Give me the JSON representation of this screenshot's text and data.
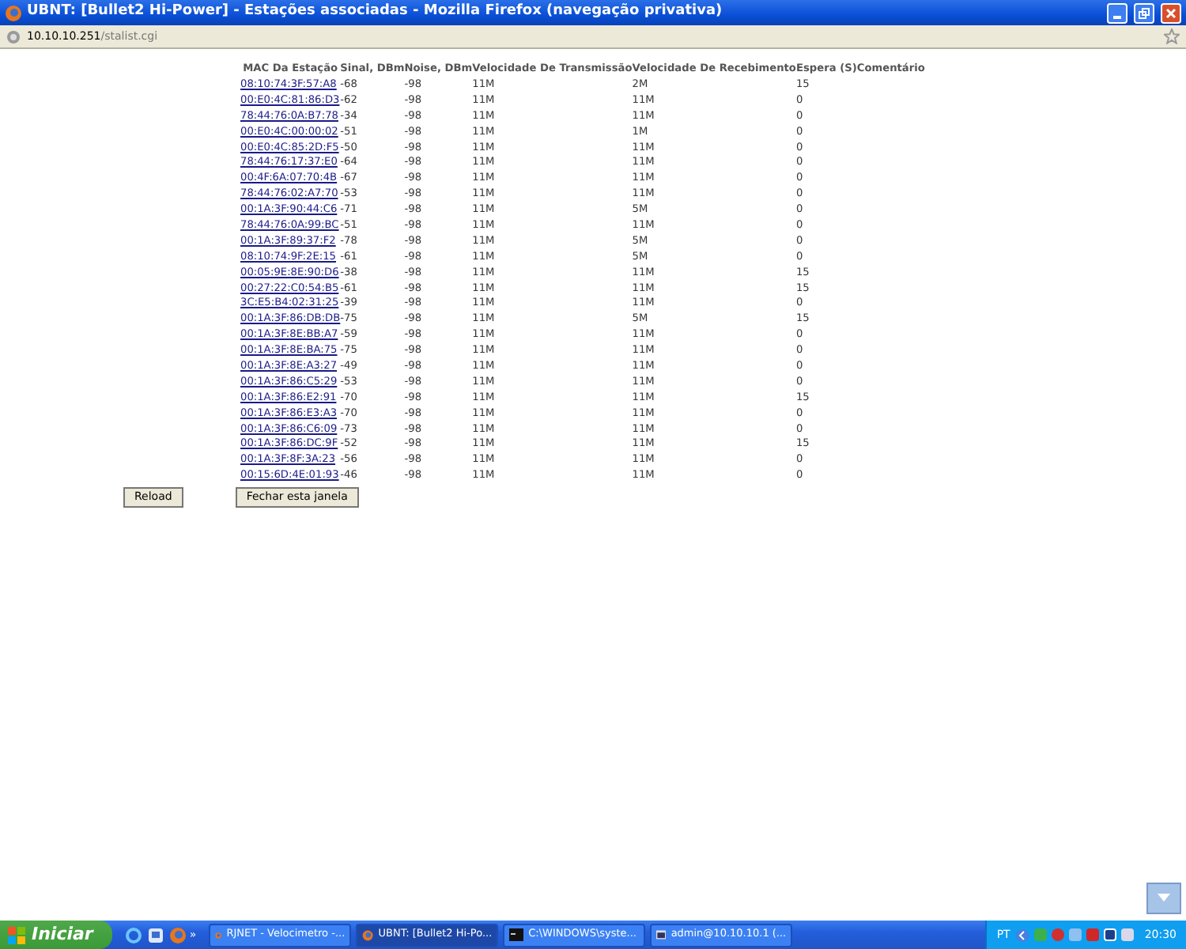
{
  "window": {
    "title": "UBNT: [Bullet2 Hi-Power] - Estações associadas - Mozilla Firefox (navegação privativa)"
  },
  "address_bar": {
    "host": "10.10.10.251",
    "path": "/stalist.cgi"
  },
  "table": {
    "columns": [
      "MAC Da Estação",
      "Sinal, DBm",
      "Noise, DBm",
      "Velocidade De Transmissão",
      "Velocidade De Recebimento",
      "Espera (S)",
      "Comentário"
    ],
    "rows": [
      [
        "08:10:74:3F:57:A8",
        "-68",
        "-98",
        "11M",
        "2M",
        "15"
      ],
      [
        "00:E0:4C:81:86:D3",
        "-62",
        "-98",
        "11M",
        "11M",
        "0"
      ],
      [
        "78:44:76:0A:B7:78",
        "-34",
        "-98",
        "11M",
        "11M",
        "0"
      ],
      [
        "00:E0:4C:00:00:02",
        "-51",
        "-98",
        "11M",
        "1M",
        "0"
      ],
      [
        "00:E0:4C:85:2D:F5",
        "-50",
        "-98",
        "11M",
        "11M",
        "0"
      ],
      [
        "78:44:76:17:37:E0",
        "-64",
        "-98",
        "11M",
        "11M",
        "0"
      ],
      [
        "00:4F:6A:07:70:4B",
        "-67",
        "-98",
        "11M",
        "11M",
        "0"
      ],
      [
        "78:44:76:02:A7:70",
        "-53",
        "-98",
        "11M",
        "11M",
        "0"
      ],
      [
        "00:1A:3F:90:44:C6",
        "-71",
        "-98",
        "11M",
        "5M",
        "0"
      ],
      [
        "78:44:76:0A:99:BC",
        "-51",
        "-98",
        "11M",
        "11M",
        "0"
      ],
      [
        "00:1A:3F:89:37:F2",
        "-78",
        "-98",
        "11M",
        "5M",
        "0"
      ],
      [
        "08:10:74:9F:2E:15",
        "-61",
        "-98",
        "11M",
        "5M",
        "0"
      ],
      [
        "00:05:9E:8E:90:D6",
        "-38",
        "-98",
        "11M",
        "11M",
        "15"
      ],
      [
        "00:27:22:C0:54:B5",
        "-61",
        "-98",
        "11M",
        "11M",
        "15"
      ],
      [
        "3C:E5:B4:02:31:25",
        "-39",
        "-98",
        "11M",
        "11M",
        "0"
      ],
      [
        "00:1A:3F:86:DB:DB",
        "-75",
        "-98",
        "11M",
        "5M",
        "15"
      ],
      [
        "00:1A:3F:8E:BB:A7",
        "-59",
        "-98",
        "11M",
        "11M",
        "0"
      ],
      [
        "00:1A:3F:8E:BA:75",
        "-75",
        "-98",
        "11M",
        "11M",
        "0"
      ],
      [
        "00:1A:3F:8E:A3:27",
        "-49",
        "-98",
        "11M",
        "11M",
        "0"
      ],
      [
        "00:1A:3F:86:C5:29",
        "-53",
        "-98",
        "11M",
        "11M",
        "0"
      ],
      [
        "00:1A:3F:86:E2:91",
        "-70",
        "-98",
        "11M",
        "11M",
        "15"
      ],
      [
        "00:1A:3F:86:E3:A3",
        "-70",
        "-98",
        "11M",
        "11M",
        "0"
      ],
      [
        "00:1A:3F:86:C6:09",
        "-73",
        "-98",
        "11M",
        "11M",
        "0"
      ],
      [
        "00:1A:3F:86:DC:9F",
        "-52",
        "-98",
        "11M",
        "11M",
        "15"
      ],
      [
        "00:1A:3F:8F:3A:23",
        "-56",
        "-98",
        "11M",
        "11M",
        "0"
      ],
      [
        "00:15:6D:4E:01:93",
        "-46",
        "-98",
        "11M",
        "11M",
        "0"
      ]
    ]
  },
  "buttons": [
    "Reload",
    "Fechar esta janela"
  ],
  "taskbar": {
    "start": "Iniciar",
    "overflow": "»",
    "tasks": [
      {
        "label": "RJNET - Velocimetro -...",
        "kind": "browser",
        "selected": false
      },
      {
        "label": "UBNT: [Bullet2 Hi-Po...",
        "kind": "browser",
        "selected": true
      },
      {
        "label": "C:\\WINDOWS\\syste...",
        "kind": "console",
        "selected": false
      },
      {
        "label": "admin@10.10.10.1 (...",
        "kind": "terminal",
        "selected": false
      }
    ],
    "language": "PT",
    "clock": "20:30"
  }
}
